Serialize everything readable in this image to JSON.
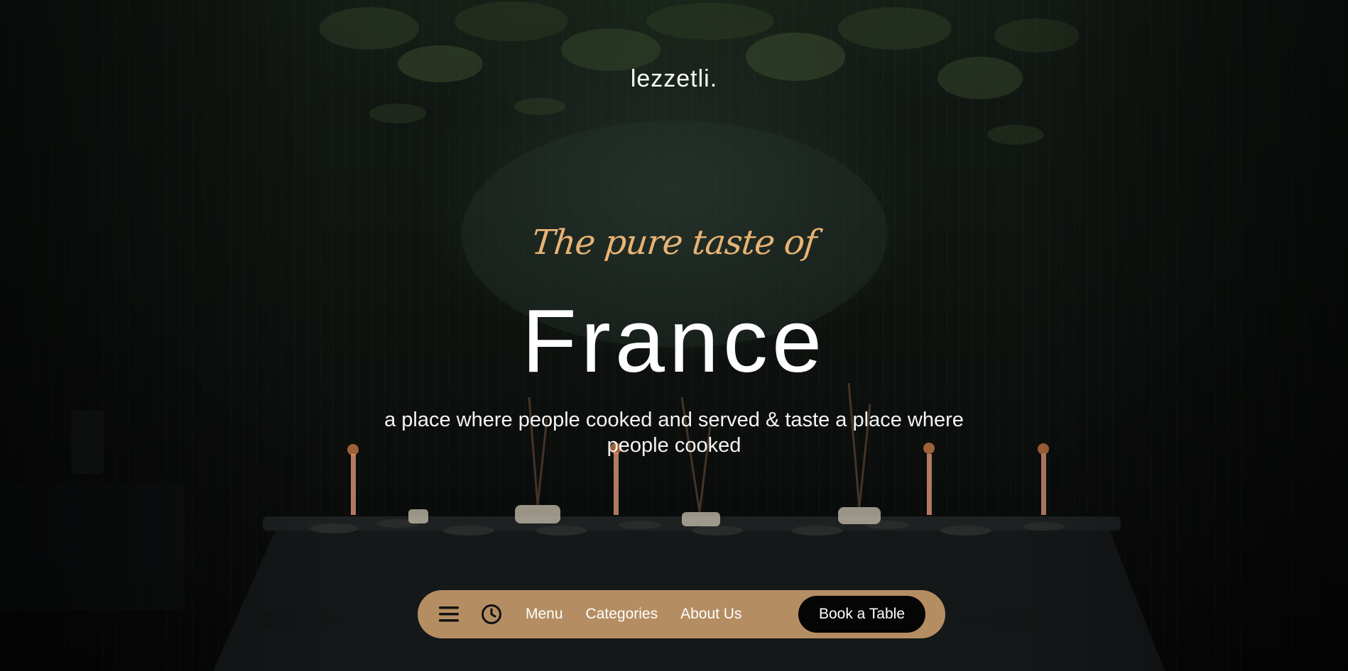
{
  "header": {
    "brand": "lezzetli."
  },
  "hero": {
    "tagline": "The pure taste of",
    "headline": "France",
    "subtitle": "a place where people cooked and served & taste a place where people cooked"
  },
  "navbar": {
    "menu_icon": "hamburger-menu-icon",
    "clock_icon": "clock-icon",
    "links": [
      {
        "label": "Menu"
      },
      {
        "label": "Categories"
      },
      {
        "label": "About Us"
      }
    ],
    "cta_label": "Book a Table"
  },
  "colors": {
    "accent": "#e8b374",
    "navbar_bg": "#b48e62",
    "button_bg": "#050505",
    "text": "#ffffff"
  }
}
